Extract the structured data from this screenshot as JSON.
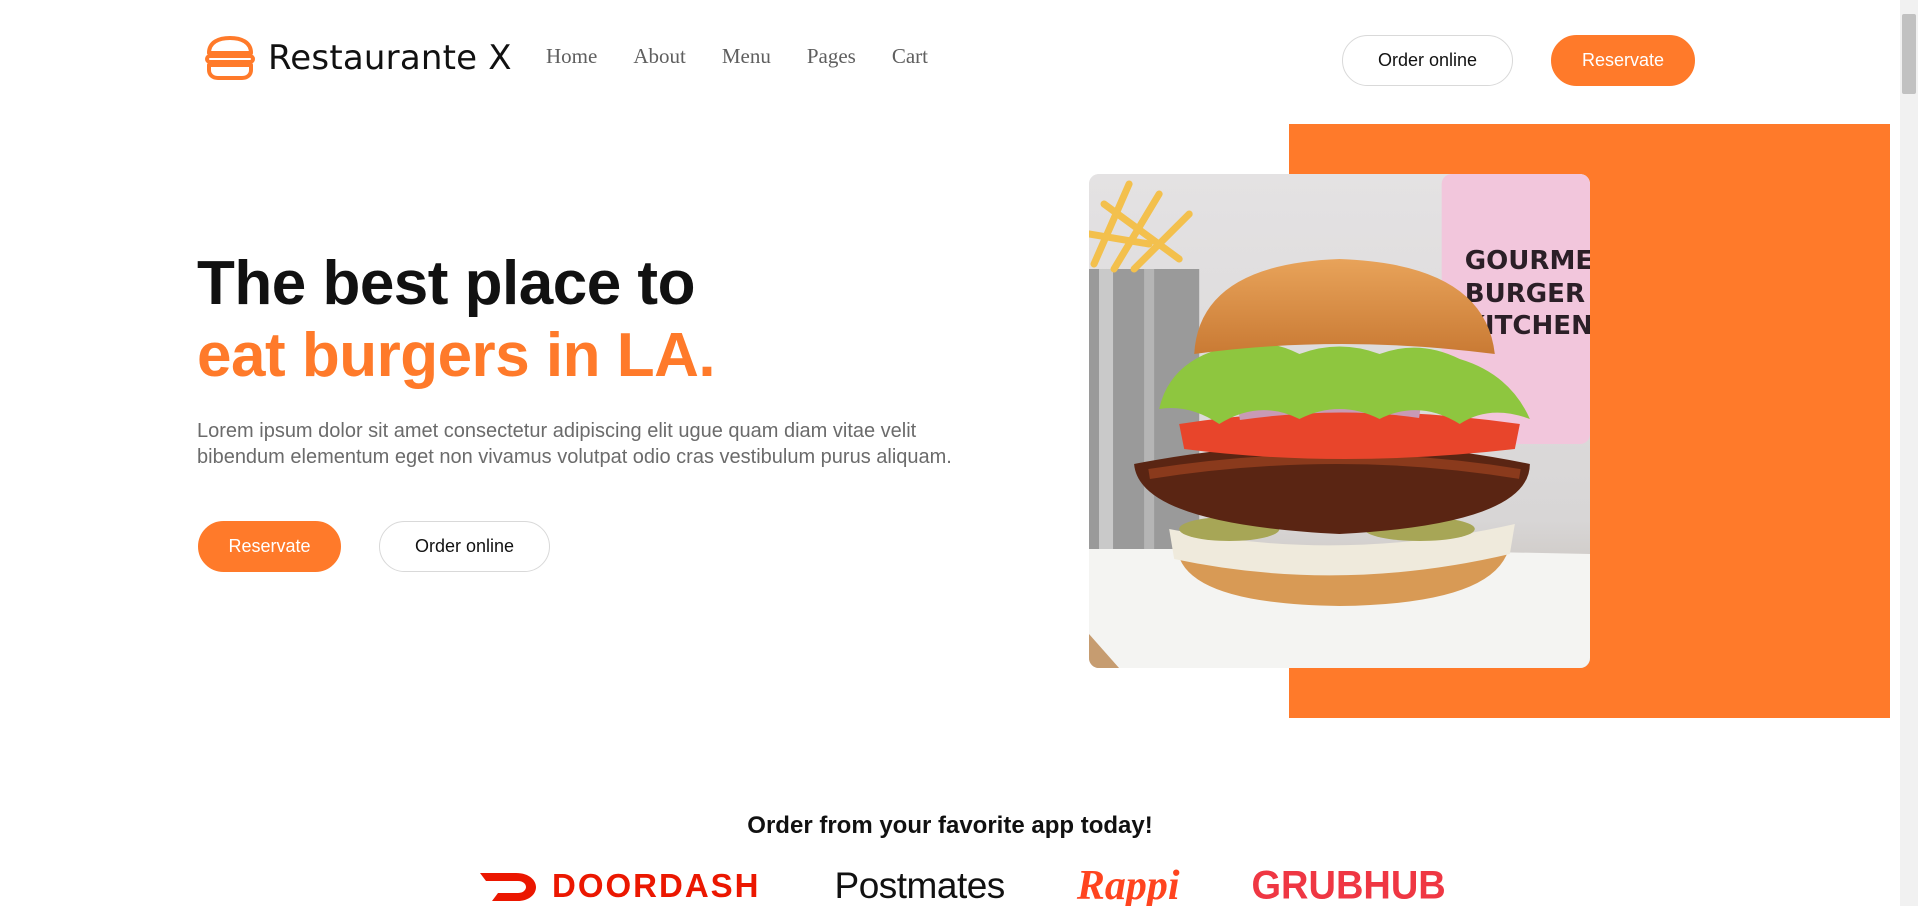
{
  "brand": {
    "name": "Restaurante X",
    "logo_icon": "burger-icon",
    "accent_color": "#ff7a2a"
  },
  "nav": {
    "items": [
      {
        "label": "Home"
      },
      {
        "label": "About"
      },
      {
        "label": "Menu"
      },
      {
        "label": "Pages"
      },
      {
        "label": "Cart"
      }
    ]
  },
  "header": {
    "order_label": "Order online",
    "reserve_label": "Reservate"
  },
  "hero": {
    "title_line1": "The best place to",
    "title_line2": "eat burgers in LA.",
    "description": "Lorem ipsum dolor sit amet consectetur adipiscing elit ugue quam diam vitae velit bibendum elementum eget non vivamus volutpat odio cras vestibulum purus aliquam.",
    "reserve_label": "Reservate",
    "order_label": "Order online",
    "image_cup_text": [
      "GOURMET",
      "BURGER",
      "KITCHEN"
    ]
  },
  "apps": {
    "title": "Order from your favorite app today!",
    "items": [
      {
        "name": "DOORDASH",
        "color": "#eb1700"
      },
      {
        "name": "Postmates",
        "color": "#111111"
      },
      {
        "name": "Rappi",
        "color": "#ff441f"
      },
      {
        "name": "GRUBHUB",
        "color": "#ef3743"
      }
    ]
  }
}
